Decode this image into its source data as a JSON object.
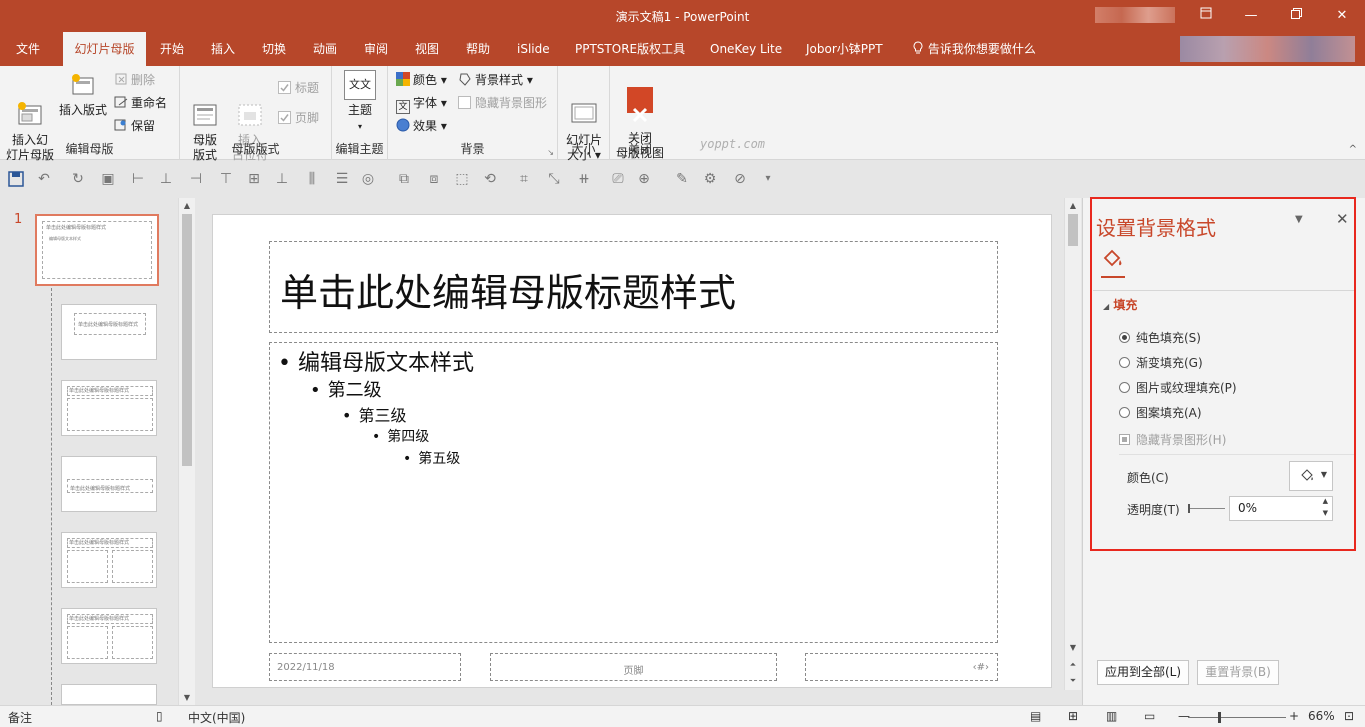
{
  "window": {
    "title": "演示文稿1  -  PowerPoint",
    "min": "—",
    "restore_icon": "▭",
    "close": "✕"
  },
  "tabs": [
    "文件",
    "幻灯片母版",
    "开始",
    "插入",
    "切换",
    "动画",
    "审阅",
    "视图",
    "帮助",
    "iSlide",
    "PPTSTORE版权工具",
    "OneKey Lite",
    "Jobor小钵PPT",
    "告诉我你想要做什么"
  ],
  "ribbon": {
    "edit_master": {
      "label": "编辑母版",
      "insert_slide_master": "插入幻\n灯片母版",
      "insert_layout": "插入版式",
      "delete": "删除",
      "rename": "重命名",
      "preserve": "保留"
    },
    "master_layout": {
      "label": "母版版式",
      "master_layout_btn": "母版\n版式",
      "insert_placeholder": "插入\n占位符",
      "title_cb": "标题",
      "footer_cb": "页脚"
    },
    "edit_theme": {
      "label": "编辑主题",
      "theme": "主题",
      "theme_icon_text": "文文"
    },
    "background": {
      "label": "背景",
      "colors": "颜色",
      "fonts": "字体",
      "effects": "效果",
      "bg_styles": "背景样式",
      "hide_bg": "隐藏背景图形"
    },
    "size": {
      "label": "大小",
      "slide_size": "幻灯片\n大小"
    },
    "close": {
      "label": "关闭",
      "close_master": "关闭\n母版视图"
    },
    "watermark": "yoppt.com"
  },
  "thumb_pane": {
    "first_number": "1",
    "thumb_title": "单击此处编辑母版标题样式",
    "thumb_body": "编辑母版文本样式"
  },
  "slide": {
    "title": "单击此处编辑母版标题样式",
    "levels": [
      "编辑母版文本样式",
      "第二级",
      "第三级",
      "第四级",
      "第五级"
    ],
    "date": "2022/11/18",
    "footer": "页脚",
    "number": "‹#›"
  },
  "format_pane": {
    "title": "设置背景格式",
    "section": "填充",
    "options": [
      "纯色填充(S)",
      "渐变填充(G)",
      "图片或纹理填充(P)",
      "图案填充(A)"
    ],
    "selected_index": 0,
    "hide_bg_graphics": "隐藏背景图形(H)",
    "color_label": "颜色(C)",
    "transparency_label": "透明度(T)",
    "transparency_value": "0%",
    "apply_all": "应用到全部(L)",
    "reset_bg": "重置背景(B)"
  },
  "status": {
    "notes": "备注",
    "language": "中文(中国)",
    "zoom": "66%",
    "minus": "—",
    "plus": "+"
  },
  "colors": {
    "accent": "#b7472a",
    "highlight": "#e8281e"
  }
}
